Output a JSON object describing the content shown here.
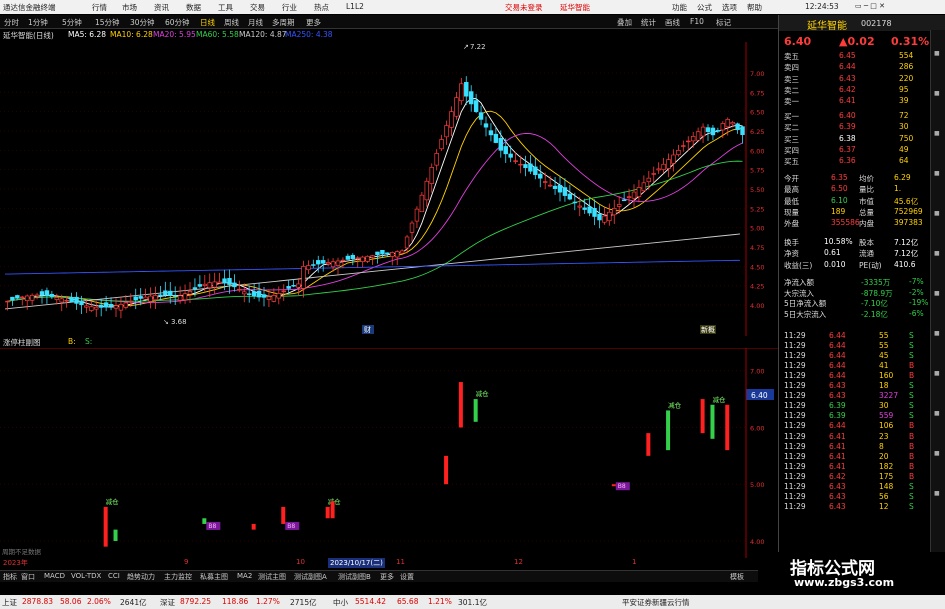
{
  "titlebar": {
    "app_name": "通达信金融终端",
    "menus": [
      "行情",
      "市场",
      "资讯",
      "数据",
      "工具",
      "交易",
      "行业",
      "热点",
      "L1L2"
    ],
    "trade_login": "交易未登录",
    "stock": "延华智能",
    "right_menus": [
      "功能",
      "公式",
      "选项",
      "帮助"
    ],
    "time": "12:24:53",
    "toolbar": [
      "F10",
      "新闻",
      "后退",
      "返回"
    ]
  },
  "period_bar": {
    "items": [
      "分时",
      "1分钟",
      "5分钟",
      "15分钟",
      "30分钟",
      "60分钟",
      "日线",
      "周线",
      "月线",
      "多周期",
      "更多"
    ],
    "active": "日线",
    "right_items": [
      "叠加",
      "统计",
      "画线",
      "F10",
      "标记"
    ]
  },
  "ma_legend": {
    "stock_label": "延华智能(日线)",
    "ma5": "MA5: 6.28",
    "ma10": "MA10: 6.28",
    "ma20": "MA20: 5.95",
    "ma60": "MA60: 5.58",
    "ma120": "MA120: 4.87",
    "ma250": "MA250: 4.38",
    "colors": {
      "ma5": "#ffffff",
      "ma10": "#ffd200",
      "ma20": "#e040e0",
      "ma60": "#33d04a",
      "ma120": "#cccccc",
      "ma250": "#3355ff"
    }
  },
  "main_chart": {
    "high_label": "7.22",
    "low_label": "3.68",
    "y_ticks": [
      "7.00",
      "6.75",
      "6.50",
      "6.25",
      "6.00",
      "5.75",
      "5.50",
      "5.25",
      "5.00",
      "4.75",
      "4.50",
      "4.25",
      "4.00"
    ],
    "markers": [
      "财",
      "新概"
    ]
  },
  "sub_chart": {
    "title": "涨停柱副图",
    "legend_b": "B:",
    "legend_s": "S:",
    "price_tag": "6.40",
    "y_ticks": [
      "7.00",
      "6.00",
      "5.00",
      "4.00"
    ],
    "buy_label": "减仓",
    "sell_label": "B8",
    "note": "周期不足数据"
  },
  "x_axis": {
    "labels": [
      "2023年",
      "9",
      "10",
      "2023/10/17(二)",
      "11",
      "12",
      "1"
    ],
    "active": "2023/10/17(二)"
  },
  "indicator_tabs": [
    "指标",
    "窗口",
    "MACD",
    "VOL-TDX",
    "CCI",
    "趋势动力",
    "主力监控",
    "私募主图",
    "MA2",
    "测试主图",
    "测试副图A",
    "测试副图B",
    "更多",
    "设置"
  ],
  "indicator_tabs_right": "模板",
  "right_panel": {
    "name": "延华智能",
    "code": "002178",
    "price": "6.40",
    "change": "▲0.02",
    "pct": "0.31%",
    "asks": [
      {
        "label": "卖五",
        "price": "6.45",
        "vol": "554"
      },
      {
        "label": "卖四",
        "price": "6.44",
        "vol": "286"
      },
      {
        "label": "卖三",
        "price": "6.43",
        "vol": "220"
      },
      {
        "label": "卖二",
        "price": "6.42",
        "vol": "95"
      },
      {
        "label": "卖一",
        "price": "6.41",
        "vol": "39"
      }
    ],
    "bids": [
      {
        "label": "买一",
        "price": "6.40",
        "vol": "72"
      },
      {
        "label": "买二",
        "price": "6.39",
        "vol": "30"
      },
      {
        "label": "买三",
        "price": "6.38",
        "vol": "750"
      },
      {
        "label": "买四",
        "price": "6.37",
        "vol": "49"
      },
      {
        "label": "买五",
        "price": "6.36",
        "vol": "64"
      }
    ],
    "stats": [
      {
        "l1": "今开",
        "v1": "6.35",
        "l2": "均价",
        "v2": "6.29"
      },
      {
        "l1": "最高",
        "v1": "6.50",
        "l2": "量比",
        "v2": "1."
      },
      {
        "l1": "最低",
        "v1": "6.10",
        "l2": "市值",
        "v2": "45.6亿"
      },
      {
        "l1": "现量",
        "v1": "189",
        "l2": "总量",
        "v2": "752969"
      },
      {
        "l1": "外盘",
        "v1": "355586",
        "l2": "内盘",
        "v2": "397383"
      }
    ],
    "stats2": [
      {
        "l1": "换手",
        "v1": "10.58%",
        "l2": "股本",
        "v2": "7.12亿"
      },
      {
        "l1": "净资",
        "v1": "0.61",
        "l2": "流通",
        "v2": "7.12亿"
      },
      {
        "l1": "收益(三)",
        "v1": "0.010",
        "l2": "PE(动)",
        "v2": "410.6"
      }
    ],
    "flows": [
      {
        "label": "净流入额",
        "value": "-3335万",
        "pct": "-7%"
      },
      {
        "label": "大宗流入",
        "value": "-878.9万",
        "pct": "-2%"
      },
      {
        "label": "5日净流入额",
        "value": "-7.10亿",
        "pct": "-19%"
      },
      {
        "label": "5日大宗流入",
        "value": "-2.18亿",
        "pct": "-6%"
      }
    ],
    "ticks": [
      {
        "t": "11:29",
        "p": "6.44",
        "v": "55",
        "d": "S"
      },
      {
        "t": "11:29",
        "p": "6.44",
        "v": "55",
        "d": "S"
      },
      {
        "t": "11:29",
        "p": "6.44",
        "v": "45",
        "d": "S"
      },
      {
        "t": "11:29",
        "p": "6.44",
        "v": "41",
        "d": "B"
      },
      {
        "t": "11:29",
        "p": "6.44",
        "v": "160",
        "d": "B"
      },
      {
        "t": "11:29",
        "p": "6.43",
        "v": "18",
        "d": "S"
      },
      {
        "t": "11:29",
        "p": "6.43",
        "v": "3227",
        "d": "S"
      },
      {
        "t": "11:29",
        "p": "6.39",
        "v": "30",
        "d": "S"
      },
      {
        "t": "11:29",
        "p": "6.39",
        "v": "559",
        "d": "S"
      },
      {
        "t": "11:29",
        "p": "6.44",
        "v": "106",
        "d": "B"
      },
      {
        "t": "11:29",
        "p": "6.41",
        "v": "23",
        "d": "B"
      },
      {
        "t": "11:29",
        "p": "6.41",
        "v": "8",
        "d": "B"
      },
      {
        "t": "11:29",
        "p": "6.41",
        "v": "20",
        "d": "B"
      },
      {
        "t": "11:29",
        "p": "6.41",
        "v": "182",
        "d": "B"
      },
      {
        "t": "11:29",
        "p": "6.42",
        "v": "175",
        "d": "B"
      },
      {
        "t": "11:29",
        "p": "6.43",
        "v": "148",
        "d": "S"
      },
      {
        "t": "11:29",
        "p": "6.43",
        "v": "56",
        "d": "S"
      },
      {
        "t": "11:29",
        "p": "6.43",
        "v": "12",
        "d": "S"
      }
    ]
  },
  "statusbar": {
    "sh_label": "上证",
    "sh_value": "2878.83",
    "sh_change": "58.06",
    "sh_pct": "2.06%",
    "sh_amount": "2641亿",
    "sz_label": "深证",
    "sz_value": "8792.25",
    "sz_change": "118.86",
    "sz_pct": "1.27%",
    "sz_amount": "2715亿",
    "zx_label": "中小",
    "zx_value": "5514.42",
    "zx_change": "65.68",
    "zx_pct": "1.21%",
    "zx_amount": "301.1亿",
    "broker": "平安证券新疆云行情"
  },
  "watermark": {
    "title": "指标公式网",
    "url": "www.zbgs3.com"
  }
}
